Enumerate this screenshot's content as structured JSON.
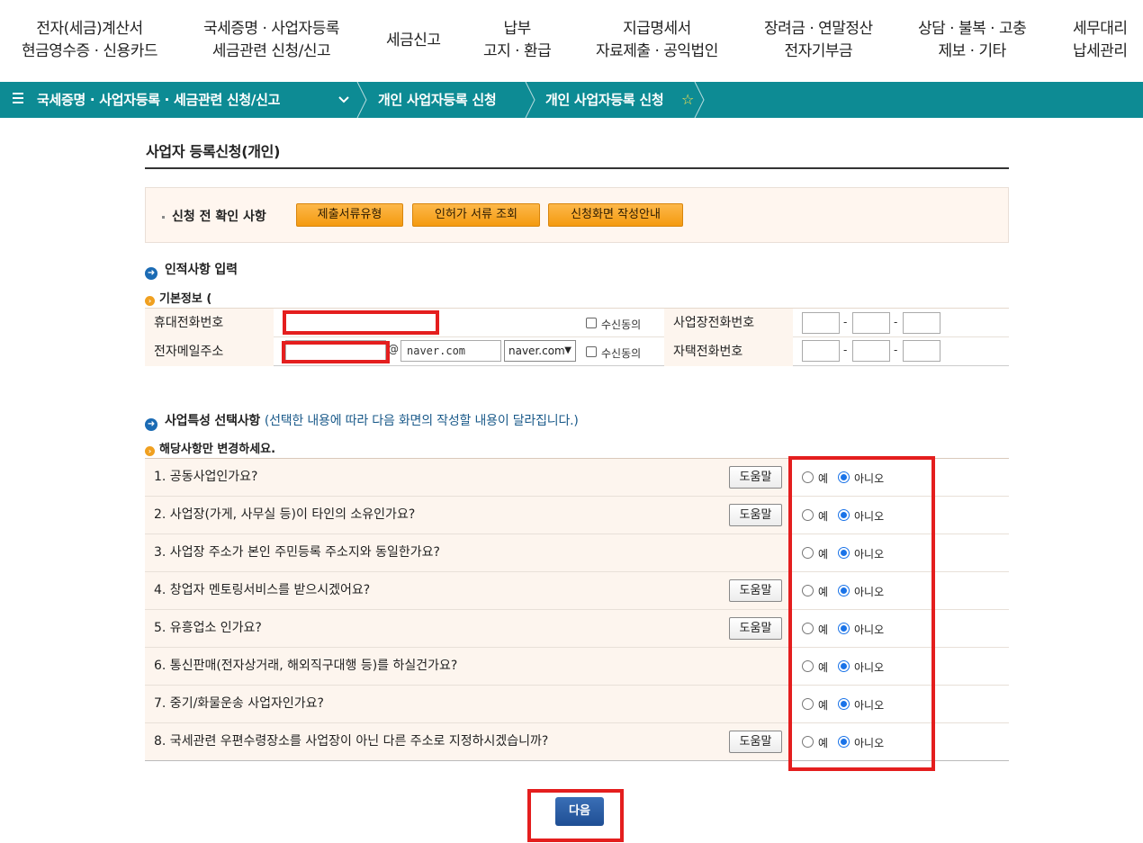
{
  "topnav": {
    "items": [
      {
        "line1": "전자(세금)계산서",
        "line2": "현금영수증 · 신용카드"
      },
      {
        "line1": "국세증명 · 사업자등록",
        "line2": "세금관련 신청/신고"
      },
      {
        "line1": "세금신고",
        "line2": ""
      },
      {
        "line1": "납부",
        "line2": "고지 · 환급"
      },
      {
        "line1": "지급명세서",
        "line2": "자료제출 · 공익법인"
      },
      {
        "line1": "장려금 · 연말정산",
        "line2": "전자기부금"
      },
      {
        "line1": "상담 · 불복 · 고충",
        "line2": "제보 · 기타"
      },
      {
        "line1": "세무대리",
        "line2": "납세관리"
      }
    ]
  },
  "breadcrumb": {
    "menu": "국세증명 · 사업자등록 · 세금관련 신청/신고",
    "level2": "개인 사업자등록 신청",
    "level3": "개인 사업자등록 신청",
    "star": "☆"
  },
  "page": {
    "title": "사업자 등록신청(개인)"
  },
  "precheck": {
    "label": "신청 전 확인 사항",
    "buttons": [
      "제출서류유형",
      "인허가 서류 조회",
      "신청화면 작성안내"
    ]
  },
  "identity": {
    "section_title": "인적사항 입력",
    "sub_title": "기본정보 (",
    "mobile_label": "휴대전화번호",
    "email_label": "전자메일주소",
    "consent_label": "수신동의",
    "at": "@",
    "email_domain": "naver.com",
    "email_select": "naver.com",
    "business_phone_label": "사업장전화번호",
    "home_phone_label": "자택전화번호",
    "dash": "-"
  },
  "business": {
    "section_title": "사업특성 선택사항",
    "section_note": "(선택한 내용에 따라 다음 화면의 작성할 내용이 달라집니다.)",
    "sub_title": "해당사항만 변경하세요.",
    "help_label": "도움말",
    "yes_label": "예",
    "no_label": "아니오",
    "questions": [
      {
        "text": "1. 공동사업인가요?",
        "help": true
      },
      {
        "text": "2. 사업장(가게, 사무실 등)이 타인의 소유인가요?",
        "help": true
      },
      {
        "text": "3. 사업장 주소가 본인 주민등록 주소지와 동일한가요?",
        "help": false
      },
      {
        "text": "4. 창업자 멘토링서비스를 받으시겠어요?",
        "help": true
      },
      {
        "text": "5. 유흥업소 인가요?",
        "help": true
      },
      {
        "text": "6. 통신판매(전자상거래, 해외직구대행 등)를 하실건가요?",
        "help": false
      },
      {
        "text": "7. 중기/화물운송 사업자인가요?",
        "help": false
      },
      {
        "text": "8. 국세관련 우편수령장소를 사업장이 아닌 다른 주소로 지정하시겠습니까?",
        "help": true
      }
    ]
  },
  "footer": {
    "next_label": "다음"
  },
  "colors": {
    "teal_bar": "#0d8b94",
    "orange_button": "#f49a0f",
    "highlight_red": "#e41e1e",
    "next_blue": "#2a5ea6"
  }
}
